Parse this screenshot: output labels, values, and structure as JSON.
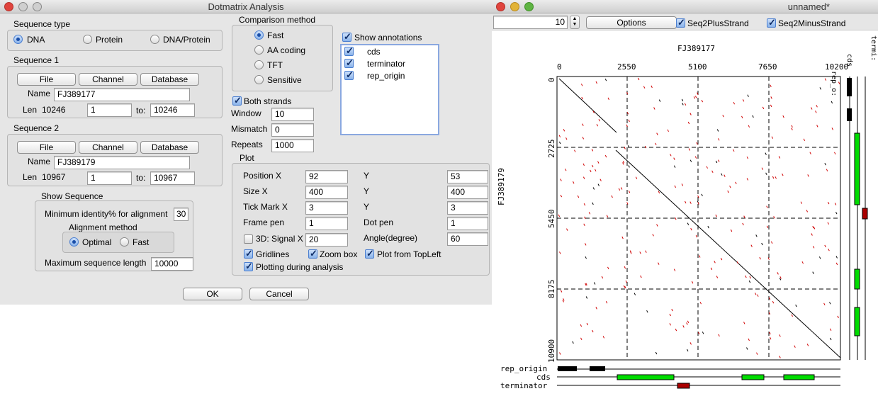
{
  "left_window": {
    "title": "Dotmatrix Analysis",
    "sequence_type": {
      "label": "Sequence type",
      "options": [
        "DNA",
        "Protein",
        "DNA/Protein"
      ],
      "selected": "DNA"
    },
    "sequence1": {
      "label": "Sequence 1",
      "buttons": [
        "File",
        "Channel",
        "Database"
      ],
      "name_label": "Name",
      "name": "FJ389177",
      "len_label": "Len",
      "len": "10246",
      "from": "1",
      "to_label": "to:",
      "to": "10246"
    },
    "sequence2": {
      "label": "Sequence 2",
      "buttons": [
        "File",
        "Channel",
        "Database"
      ],
      "name_label": "Name",
      "name": "FJ389179",
      "len_label": "Len",
      "len": "10967",
      "from": "1",
      "to_label": "to:",
      "to": "10967"
    },
    "show_sequence": {
      "label": "Show Sequence",
      "min_identity_label": "Minimum identity% for alignment",
      "min_identity": "30",
      "alignment_method_label": "Alignment method",
      "methods": [
        "Optimal",
        "Fast"
      ],
      "selected": "Optimal",
      "max_len_label": "Maximum sequence length",
      "max_len": "10000"
    },
    "comparison": {
      "label": "Comparison method",
      "options": [
        "Fast",
        "AA coding",
        "TFT",
        "Sensitive"
      ],
      "selected": "Fast"
    },
    "both_strands": "Both strands",
    "window_label": "Window",
    "window": "10",
    "mismatch_label": "Mismatch",
    "mismatch": "0",
    "repeats_label": "Repeats",
    "repeats": "1000",
    "annotations": {
      "label": "Show annotations",
      "items": [
        "cds",
        "terminator",
        "rep_origin"
      ]
    },
    "plot": {
      "label": "Plot",
      "position_x_label": "Position X",
      "position_x": "92",
      "y_label": "Y",
      "position_y": "53",
      "size_x_label": "Size X",
      "size_x": "400",
      "size_y": "400",
      "tick_x_label": "Tick Mark X",
      "tick_x": "3",
      "tick_y": "3",
      "frame_pen_label": "Frame pen",
      "frame_pen": "1",
      "dot_pen_label": "Dot pen",
      "dot_pen": "1",
      "signal_label": "3D: Signal X",
      "signal_x": "20",
      "angle_label": "Angle(degree)",
      "angle": "60",
      "gridlines": "Gridlines",
      "zoom_box": "Zoom box",
      "topleft": "Plot from TopLeft",
      "plotting": "Plotting during analysis"
    },
    "ok": "OK",
    "cancel": "Cancel"
  },
  "right_window": {
    "title": "unnamed*",
    "stepper_value": "10",
    "options_button": "Options",
    "seq2_plus": "Seq2PlusStrand",
    "seq2_minus": "Seq2MinusStrand",
    "x_seq_name": "FJ389177",
    "y_seq_name": "FJ389179",
    "x_ticks": [
      "0",
      "2550",
      "5100",
      "7650",
      "10200"
    ],
    "y_ticks": [
      "0",
      "2725",
      "5450",
      "8175",
      "10900"
    ],
    "right_track_labels": [
      "rep_o:",
      "cds",
      "termi:"
    ],
    "bottom_track_labels": [
      "rep_origin",
      "cds",
      "terminator"
    ],
    "colors": {
      "main_diag": "#000000",
      "dots": "#d00000",
      "cds": "#00dd00",
      "rep": "#000000",
      "term": "#aa0000"
    }
  }
}
